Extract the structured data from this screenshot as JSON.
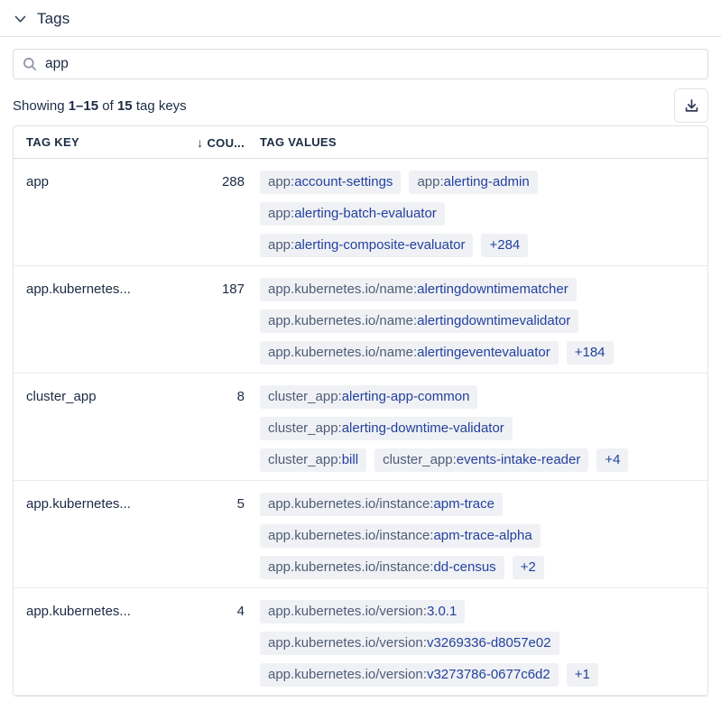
{
  "section": {
    "title": "Tags"
  },
  "search": {
    "value": "app"
  },
  "meta": {
    "showing": "Showing",
    "range": "1–15",
    "of": "of",
    "total": "15",
    "suffix": "tag keys"
  },
  "toolbar": {
    "download_icon": "download-icon"
  },
  "colors": {
    "text_dark": "#1c2b44",
    "pill_background": "#f0f1f4",
    "pill_key_text": "#4e5c79",
    "pill_value_text": "#23419f",
    "border": "#e0e3e9"
  },
  "table": {
    "headers": {
      "key": "TAG KEY",
      "count": "COU...",
      "values": "TAG VALUES"
    },
    "sort_icon": "↓",
    "rows": [
      {
        "key": "app",
        "count": "288",
        "value_lines": [
          [
            "app:account-settings",
            "app:alerting-admin"
          ],
          [
            "app:alerting-batch-evaluator"
          ],
          [
            "app:alerting-composite-evaluator",
            "+284"
          ]
        ]
      },
      {
        "key": "app.kubernetes...",
        "count": "187",
        "value_lines": [
          [
            "app.kubernetes.io/name:alertingdowntimematcher"
          ],
          [
            "app.kubernetes.io/name:alertingdowntimevalidator"
          ],
          [
            "app.kubernetes.io/name:alertingeventevaluator",
            "+184"
          ]
        ]
      },
      {
        "key": "cluster_app",
        "count": "8",
        "value_lines": [
          [
            "cluster_app:alerting-app-common"
          ],
          [
            "cluster_app:alerting-downtime-validator"
          ],
          [
            "cluster_app:bill",
            "cluster_app:events-intake-reader",
            "+4"
          ]
        ]
      },
      {
        "key": "app.kubernetes...",
        "count": "5",
        "value_lines": [
          [
            "app.kubernetes.io/instance:apm-trace"
          ],
          [
            "app.kubernetes.io/instance:apm-trace-alpha"
          ],
          [
            "app.kubernetes.io/instance:dd-census",
            "+2"
          ]
        ]
      },
      {
        "key": "app.kubernetes...",
        "count": "4",
        "value_lines": [
          [
            "app.kubernetes.io/version:3.0.1"
          ],
          [
            "app.kubernetes.io/version:v3269336-d8057e02"
          ],
          [
            "app.kubernetes.io/version:v3273786-0677c6d2",
            "+1"
          ]
        ]
      }
    ]
  }
}
